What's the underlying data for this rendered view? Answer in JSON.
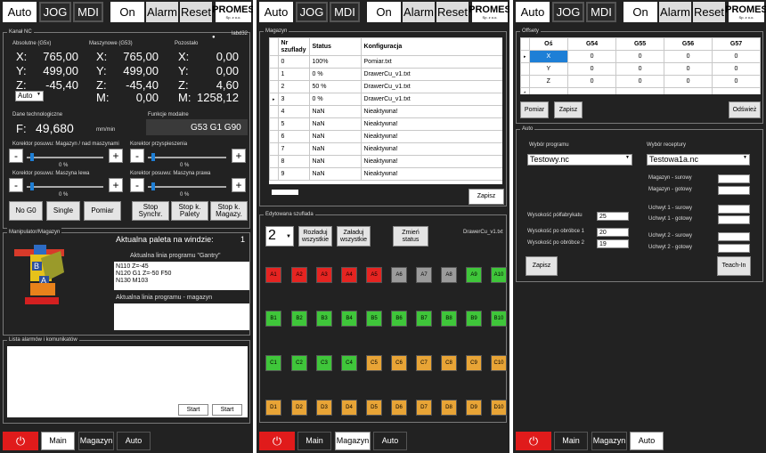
{
  "topbar": {
    "auto": "Auto",
    "jog": "JOG",
    "mdi": "MDI",
    "on": "On",
    "alarm": "Alarm",
    "reset": "Reset",
    "logo": "PROMES",
    "logo_sub": "Sp. z o.o."
  },
  "bottombar": {
    "main": "Main",
    "magazyn": "Magazyn",
    "auto": "Auto",
    "power_icon": "power-icon"
  },
  "p1": {
    "kanal": {
      "title": "Kanał NC",
      "id": "labd32",
      "abs_label": "Absolutne (G5x)",
      "mach_label": "Maszynowe (G53)",
      "rem_label": "Pozostało",
      "axes": [
        "X:",
        "Y:",
        "Z:",
        "M:"
      ],
      "abs": [
        "765,00",
        "499,00",
        "-45,40"
      ],
      "mach": [
        "765,00",
        "499,00",
        "-45,40",
        "0,00"
      ],
      "rem": [
        "0,00",
        "0,00",
        "4,60",
        "1258,12"
      ],
      "mode_select": "Auto",
      "tech_label": "Dane technologiczne",
      "modal_label": "Funkcje modalne",
      "feed_axis": "F:",
      "feed": "49,680",
      "feed_unit": "mm/min",
      "modal": "G53 G1 G90"
    },
    "override": {
      "l1": "Korektor posuwu: Magazyn / nad maszynami",
      "l2": "Korektor przyspieszenia",
      "l3": "Korektor posuwu: Maszyna lewa",
      "l4": "Korektor posuwu: Maszyna prawa",
      "v1": "0 %",
      "v2": "0 %",
      "v3": "0 %",
      "v4": "0 %",
      "minus": "-",
      "plus": "+"
    },
    "buttons": [
      "No G0",
      "Single",
      "Pomiar",
      "Stop Synchr.",
      "Stop k. Palety",
      "Stop k. Magazy."
    ],
    "manip": {
      "title": "Manipulator/Magazyn",
      "pallet_label": "Aktualna paleta na windzie:",
      "pallet": "1",
      "gantry_label": "Aktualna linia programu \"Gantry\"",
      "gantry_lines": [
        "N110 Z=-45",
        "N120 G1 Z=-50 F50",
        "N130 M103"
      ],
      "mag_label": "Aktualna linia programu - magazyn"
    },
    "alarms": {
      "title": "Lista alarmów i komunikatów",
      "start": "Start"
    }
  },
  "p2": {
    "mag": {
      "title": "Magazyn",
      "headers": [
        "Nr szuflady",
        "Status",
        "Konfiguracja"
      ],
      "rows": [
        {
          "nr": "0",
          "status": "100%",
          "config": "Pomiar.txt"
        },
        {
          "nr": "1",
          "status": "0 %",
          "config": "DrawerCu_v1.txt"
        },
        {
          "nr": "2",
          "status": "50 %",
          "config": "DrawerCu_v1.txt"
        },
        {
          "nr": "3",
          "status": "0 %",
          "config": "DrawerCu_v1.txt"
        },
        {
          "nr": "4",
          "status": "NaN",
          "config": "Nieaktywna!"
        },
        {
          "nr": "5",
          "status": "NaN",
          "config": "Nieaktywna!"
        },
        {
          "nr": "6",
          "status": "NaN",
          "config": "Nieaktywna!"
        },
        {
          "nr": "7",
          "status": "NaN",
          "config": "Nieaktywna!"
        },
        {
          "nr": "8",
          "status": "NaN",
          "config": "Nieaktywna!"
        },
        {
          "nr": "9",
          "status": "NaN",
          "config": "Nieaktywna!"
        }
      ],
      "selected_row": 3,
      "save": "Zapisz"
    },
    "drawer": {
      "title": "Edytowana szuflada",
      "number": "2",
      "unload": "Rozładuj wszystkie",
      "load": "Załaduj wszystkie",
      "change": "Zmień status",
      "config": "DrawerCu_v1.txt",
      "colors": {
        "red": "#e52421",
        "grey": "#9b9b9b",
        "green": "#3fc63a",
        "orange": "#e8a436"
      },
      "slots": [
        [
          {
            "l": "A1",
            "c": "red"
          },
          {
            "l": "A2",
            "c": "red"
          },
          {
            "l": "A3",
            "c": "red"
          },
          {
            "l": "A4",
            "c": "red"
          },
          {
            "l": "A5",
            "c": "red"
          },
          {
            "l": "A6",
            "c": "grey"
          },
          {
            "l": "A7",
            "c": "grey"
          },
          {
            "l": "A8",
            "c": "grey"
          },
          {
            "l": "A9",
            "c": "green"
          },
          {
            "l": "A10",
            "c": "green"
          }
        ],
        [
          {
            "l": "B1",
            "c": "green"
          },
          {
            "l": "B2",
            "c": "green"
          },
          {
            "l": "B3",
            "c": "green"
          },
          {
            "l": "B4",
            "c": "green"
          },
          {
            "l": "B5",
            "c": "green"
          },
          {
            "l": "B6",
            "c": "green"
          },
          {
            "l": "B7",
            "c": "green"
          },
          {
            "l": "B8",
            "c": "green"
          },
          {
            "l": "B9",
            "c": "green"
          },
          {
            "l": "B10",
            "c": "green"
          }
        ],
        [
          {
            "l": "C1",
            "c": "green"
          },
          {
            "l": "C2",
            "c": "green"
          },
          {
            "l": "C3",
            "c": "green"
          },
          {
            "l": "C4",
            "c": "green"
          },
          {
            "l": "C5",
            "c": "orange"
          },
          {
            "l": "C6",
            "c": "orange"
          },
          {
            "l": "C7",
            "c": "orange"
          },
          {
            "l": "C8",
            "c": "orange"
          },
          {
            "l": "C9",
            "c": "orange"
          },
          {
            "l": "C10",
            "c": "orange"
          }
        ],
        [
          {
            "l": "D1",
            "c": "orange"
          },
          {
            "l": "D2",
            "c": "orange"
          },
          {
            "l": "D3",
            "c": "orange"
          },
          {
            "l": "D4",
            "c": "orange"
          },
          {
            "l": "D5",
            "c": "orange"
          },
          {
            "l": "D6",
            "c": "orange"
          },
          {
            "l": "D7",
            "c": "orange"
          },
          {
            "l": "D8",
            "c": "orange"
          },
          {
            "l": "D9",
            "c": "orange"
          },
          {
            "l": "D10",
            "c": "orange"
          }
        ]
      ]
    }
  },
  "p3": {
    "offsets": {
      "title": "Offsety",
      "headers": [
        "Oś",
        "G54",
        "G55",
        "G56",
        "G57"
      ],
      "rows": [
        [
          "X",
          "0",
          "0",
          "0",
          "0"
        ],
        [
          "Y",
          "0",
          "0",
          "0",
          "0"
        ],
        [
          "Z",
          "0",
          "0",
          "0",
          "0"
        ]
      ],
      "measure": "Pomiar",
      "save": "Zapisz",
      "refresh": "Odśwież"
    },
    "auto": {
      "title": "Auto",
      "program_label": "Wybór programu",
      "recipe_label": "Wybór receptury",
      "program": "Testowy.nc",
      "recipe": "Testowa1a.nc",
      "mag_fields": [
        "Magazyn - surowy",
        "Magazyn - gotowy",
        "Uchwyt 1 - surowy",
        "Uchwyt 1 - gotowy",
        "Uchwyt 2 - surowy",
        "Uchwyt 2 - gotowy"
      ],
      "height_fields": [
        {
          "label": "Wysokość półfabrykatu",
          "value": "25"
        },
        {
          "label": "Wysokość po obróbce 1",
          "value": "20"
        },
        {
          "label": "Wysokość po obróbce 2",
          "value": "19"
        }
      ],
      "save": "Zapisz",
      "teach": "Teach-In"
    }
  }
}
